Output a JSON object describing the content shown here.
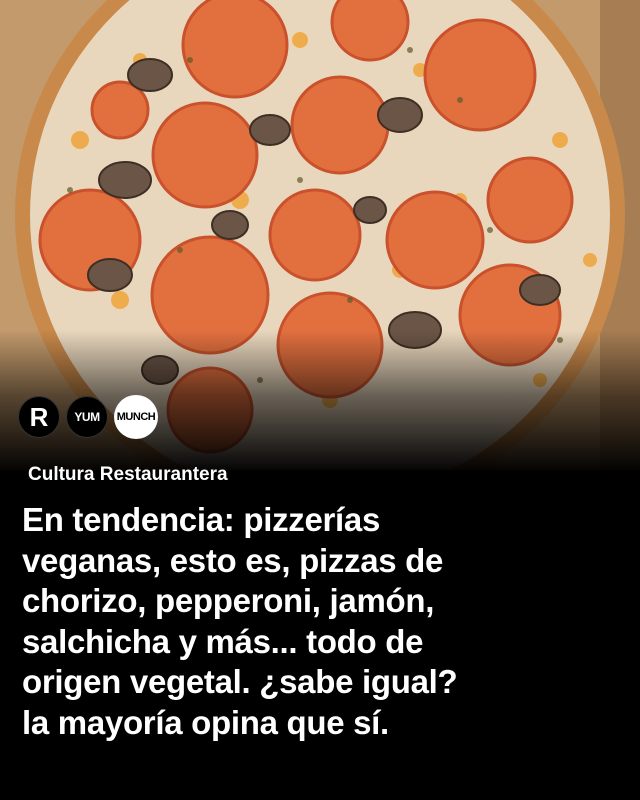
{
  "brand": {
    "logos": [
      {
        "label": "R"
      },
      {
        "label": "YUM"
      },
      {
        "label": "MUNCH"
      }
    ]
  },
  "post": {
    "section": "Cultura Restaurantera",
    "headline": " En tendencia: pizzerías\nveganas, esto es, pizzas de\nchorizo, pepperoni, jamón,\nsalchicha y más... todo de\norigen vegetal. ¿sabe igual?\nla mayoría opina que sí."
  },
  "image": {
    "subject": "pizza-photo"
  }
}
